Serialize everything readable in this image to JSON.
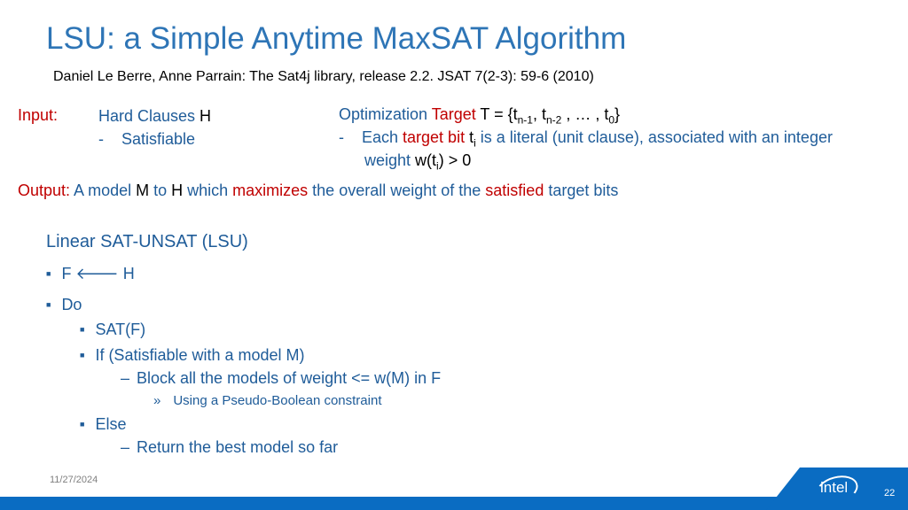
{
  "title": "LSU: a Simple Anytime MaxSAT Algorithm",
  "citation": "Daniel Le Berre, Anne Parrain: The Sat4j library, release 2.2. JSAT 7(2-3): 59-6 (2010)",
  "input": {
    "label": "Input:",
    "hard": "Hard Clauses ",
    "H": "H",
    "dash": "-",
    "satisfiable": "Satisfiable"
  },
  "target": {
    "opt": "Optimization ",
    "target": "Target",
    "t_eq": " T = {t",
    "n1": "n-1",
    "c1": ", t",
    "n2": "n-2",
    "rest": " , … , t",
    "z": "0",
    "close": "}",
    "dash": "-",
    "each": "Each ",
    "tbit": "target bit",
    "ti": " t",
    "i": "i",
    "desc": " is a literal (unit clause), associated with an integer",
    "weight": "weight ",
    "w": "w(t",
    "wi": "i",
    "gt": ") > 0"
  },
  "output": {
    "label": "Output:",
    "a": " A model ",
    "M": "M",
    "to": " to ",
    "H": "H",
    "which": " which ",
    "max": "maximizes",
    "the": " the overall weight of the ",
    "sat": "satisfied",
    "bits": " target bits"
  },
  "lsu": {
    "heading": "Linear SAT-UNSAT (LSU)",
    "items": [
      "F 🡐 H",
      "Do",
      "SAT(F)",
      "If (Satisfiable with a model M)",
      "Block all the models of weight <= w(M) in F",
      "Using a Pseudo-Boolean constraint",
      "Else",
      "Return the best model so far"
    ]
  },
  "footer": {
    "date": "11/27/2024",
    "page": "22",
    "logo": "intel"
  },
  "colors": {
    "blue": "#1f5c99",
    "red": "#c00000",
    "title": "#2e75b6",
    "bar": "#0a6cc2"
  }
}
